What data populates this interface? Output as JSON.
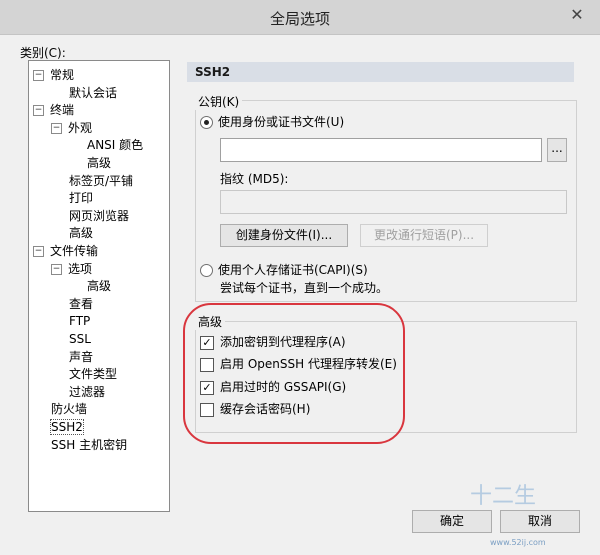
{
  "window": {
    "title": "全局选项",
    "close_glyph": "✕"
  },
  "category_label": "类别(C):",
  "tree": [
    {
      "label": "常规",
      "expander": "−"
    },
    {
      "label": "默认会话"
    },
    {
      "label": "终端",
      "expander": "−"
    },
    {
      "label": "外观",
      "expander": "−"
    },
    {
      "label": "ANSI 颜色"
    },
    {
      "label": "高级"
    },
    {
      "label": "标签页/平铺"
    },
    {
      "label": "打印"
    },
    {
      "label": "网页浏览器"
    },
    {
      "label": "高级"
    },
    {
      "label": "文件传输",
      "expander": "−"
    },
    {
      "label": "选项",
      "expander": "−"
    },
    {
      "label": "高级"
    },
    {
      "label": "查看"
    },
    {
      "label": "FTP"
    },
    {
      "label": "SSL"
    },
    {
      "label": "声音"
    },
    {
      "label": "文件类型"
    },
    {
      "label": "过滤器"
    },
    {
      "label": "防火墙"
    },
    {
      "label": "SSH2",
      "selected": true
    },
    {
      "label": "SSH 主机密钥"
    }
  ],
  "panel": {
    "heading": "SSH2",
    "public_key": {
      "group_title": "公钥(K)",
      "radio_identity_file": "使用身份或证书文件(U)",
      "identity_file_value": "",
      "browse_label": "...",
      "fingerprint_label": "指纹 (MD5):",
      "fingerprint_value": "",
      "create_identity_button": "创建身份文件(I)...",
      "change_passphrase_button": "更改通行短语(P)...",
      "radio_capi": "使用个人存储证书(CAPI)(S)",
      "capi_note": "尝试每个证书，直到一个成功。"
    },
    "advanced": {
      "group_title": "高级",
      "options": [
        {
          "label": "添加密钥到代理程序(A)",
          "checked": true
        },
        {
          "label": "启用 OpenSSH 代理程序转发(E)",
          "checked": false
        },
        {
          "label": "启用过时的 GSSAPI(G)",
          "checked": true
        },
        {
          "label": "缓存会话密码(H)",
          "checked": false
        }
      ]
    }
  },
  "footer": {
    "ok": "确定",
    "cancel": "取消"
  },
  "watermark": {
    "text": "十二生",
    "url": "www.52ij.com"
  },
  "colors": {
    "highlight_oval": "#d9363e",
    "section_header_bg": "#d9dee6"
  }
}
